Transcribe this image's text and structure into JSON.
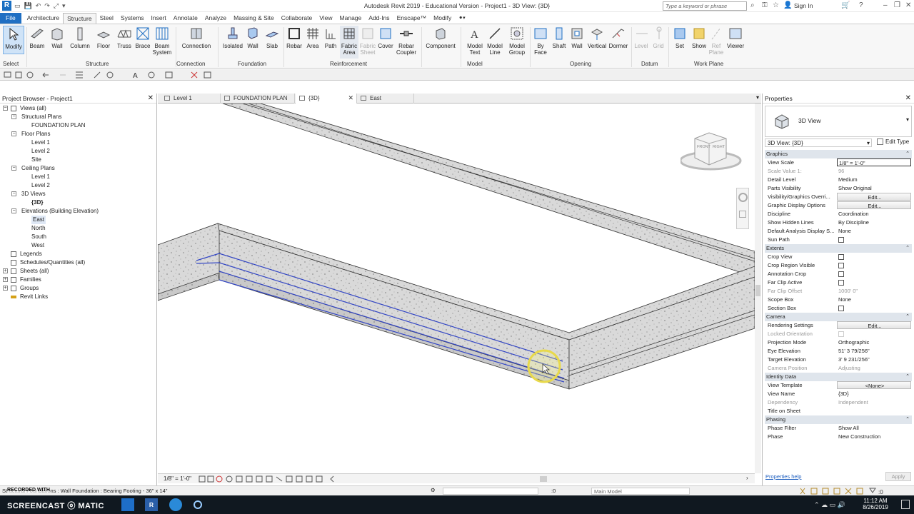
{
  "app": {
    "logo": "R",
    "title": "Autodesk Revit 2019 - Educational Version - Project1 - 3D View: {3D}",
    "search_placeholder": "Type a keyword or phrase",
    "sign_in": "Sign In"
  },
  "menu_tabs": [
    "File",
    "Architecture",
    "Structure",
    "Steel",
    "Systems",
    "Insert",
    "Annotate",
    "Analyze",
    "Massing & Site",
    "Collaborate",
    "View",
    "Manage",
    "Add-Ins",
    "Enscape™",
    "Modify"
  ],
  "active_menu_tab": "Structure",
  "ribbon": {
    "buttons": {
      "modify": "Modify",
      "beam": "Beam",
      "wall": "Wall",
      "column": "Column",
      "floor": "Floor",
      "truss": "Truss",
      "brace": "Brace",
      "beam_system": "Beam System",
      "connection": "Connection",
      "isolated": "Isolated",
      "fwall": "Wall",
      "slab": "Slab",
      "rebar": "Rebar",
      "area": "Area",
      "path": "Path",
      "fabric_area": "Fabric Area",
      "fabric_sheet": "Fabric Sheet",
      "cover": "Cover",
      "rebar_coupler": "Rebar Coupler",
      "component": "Component",
      "model_text": "Model Text",
      "model_line": "Model Line",
      "model_group": "Model Group",
      "by_face": "By Face",
      "shaft": "Shaft",
      "owall": "Wall",
      "vertical": "Vertical",
      "dormer": "Dormer",
      "level": "Level",
      "grid": "Grid",
      "set": "Set",
      "show": "Show",
      "ref_plane": "Ref Plane",
      "viewer": "Viewer"
    },
    "panels": {
      "select": "Select",
      "structure": "Structure",
      "connection": "Connection",
      "foundation": "Foundation",
      "reinforcement": "Reinforcement",
      "model": "Model",
      "opening": "Opening",
      "datum": "Datum",
      "work_plane": "Work Plane"
    }
  },
  "project_browser": {
    "title": "Project Browser - Project1",
    "items": [
      {
        "label": "Views (all)",
        "level": 0,
        "toggle": "−",
        "icon": "views"
      },
      {
        "label": "Structural Plans",
        "level": 1,
        "toggle": "−"
      },
      {
        "label": "FOUNDATION PLAN",
        "level": 2
      },
      {
        "label": "Floor Plans",
        "level": 1,
        "toggle": "−"
      },
      {
        "label": "Level 1",
        "level": 2
      },
      {
        "label": "Level 2",
        "level": 2
      },
      {
        "label": "Site",
        "level": 2
      },
      {
        "label": "Ceiling Plans",
        "level": 1,
        "toggle": "−"
      },
      {
        "label": "Level 1",
        "level": 2
      },
      {
        "label": "Level 2",
        "level": 2
      },
      {
        "label": "3D Views",
        "level": 1,
        "toggle": "−"
      },
      {
        "label": "{3D}",
        "level": 2,
        "bold": true
      },
      {
        "label": "Elevations (Building Elevation)",
        "level": 1,
        "toggle": "−"
      },
      {
        "label": "East",
        "level": 2,
        "selected": true
      },
      {
        "label": "North",
        "level": 2
      },
      {
        "label": "South",
        "level": 2
      },
      {
        "label": "West",
        "level": 2
      },
      {
        "label": "Legends",
        "level": 0,
        "icon": "sheet"
      },
      {
        "label": "Schedules/Quantities (all)",
        "level": 0,
        "icon": "sheet"
      },
      {
        "label": "Sheets (all)",
        "level": 0,
        "toggle": "+",
        "icon": "sheet"
      },
      {
        "label": "Families",
        "level": 0,
        "toggle": "+",
        "icon": "sheet"
      },
      {
        "label": "Groups",
        "level": 0,
        "toggle": "+",
        "icon": "sheet"
      },
      {
        "label": "Revit Links",
        "level": 0,
        "icon": "link"
      }
    ]
  },
  "view_tabs": [
    {
      "label": "Level 1",
      "active": false,
      "closable": false
    },
    {
      "label": "FOUNDATION PLAN",
      "active": false,
      "closable": false
    },
    {
      "label": "{3D}",
      "active": true,
      "closable": true
    },
    {
      "label": "East",
      "active": false,
      "closable": false
    }
  ],
  "viewcube": {
    "front": "FRONT",
    "right": "RIGHT"
  },
  "view_control": {
    "scale": "1/8\" = 1'-0\""
  },
  "properties": {
    "title": "Properties",
    "type_name": "3D View",
    "instance_selector": "3D View: {3D}",
    "edit_type": "Edit Type",
    "help_link": "Properties help",
    "apply": "Apply",
    "groups": [
      {
        "name": "Graphics",
        "rows": [
          {
            "name": "View Scale",
            "value": "1/8\" = 1'-0\"",
            "kind": "input"
          },
          {
            "name": "Scale Value    1:",
            "value": "96",
            "kind": "gray"
          },
          {
            "name": "Detail Level",
            "value": "Medium"
          },
          {
            "name": "Parts Visibility",
            "value": "Show Original"
          },
          {
            "name": "Visibility/Graphics Overri...",
            "value": "Edit...",
            "kind": "button"
          },
          {
            "name": "Graphic Display Options",
            "value": "Edit...",
            "kind": "button"
          },
          {
            "name": "Discipline",
            "value": "Coordination"
          },
          {
            "name": "Show Hidden Lines",
            "value": "By Discipline"
          },
          {
            "name": "Default Analysis Display S...",
            "value": "None"
          },
          {
            "name": "Sun Path",
            "value": "",
            "kind": "checkbox"
          }
        ]
      },
      {
        "name": "Extents",
        "rows": [
          {
            "name": "Crop View",
            "value": "",
            "kind": "checkbox"
          },
          {
            "name": "Crop Region Visible",
            "value": "",
            "kind": "checkbox"
          },
          {
            "name": "Annotation Crop",
            "value": "",
            "kind": "checkbox"
          },
          {
            "name": "Far Clip Active",
            "value": "",
            "kind": "checkbox"
          },
          {
            "name": "Far Clip Offset",
            "value": "1000' 0\"",
            "kind": "gray",
            "gray_name": true
          },
          {
            "name": "Scope Box",
            "value": "None"
          },
          {
            "name": "Section Box",
            "value": "",
            "kind": "checkbox"
          }
        ]
      },
      {
        "name": "Camera",
        "rows": [
          {
            "name": "Rendering Settings",
            "value": "Edit...",
            "kind": "button"
          },
          {
            "name": "Locked Orientation",
            "value": "",
            "kind": "checkbox",
            "gray_name": true
          },
          {
            "name": "Projection Mode",
            "value": "Orthographic"
          },
          {
            "name": "Eye Elevation",
            "value": "51'  3 79/256\""
          },
          {
            "name": "Target Elevation",
            "value": "3'  9 231/256\""
          },
          {
            "name": "Camera Position",
            "value": "Adjusting",
            "kind": "gray",
            "gray_name": true
          }
        ]
      },
      {
        "name": "Identity Data",
        "rows": [
          {
            "name": "View Template",
            "value": "<None>",
            "kind": "button"
          },
          {
            "name": "View Name",
            "value": "{3D}"
          },
          {
            "name": "Dependency",
            "value": "Independent",
            "kind": "gray",
            "gray_name": true
          },
          {
            "name": "Title on Sheet",
            "value": ""
          }
        ]
      },
      {
        "name": "Phasing",
        "rows": [
          {
            "name": "Phase Filter",
            "value": "Show All"
          },
          {
            "name": "Phase",
            "value": "New Construction"
          }
        ]
      }
    ]
  },
  "status": {
    "text": "Structural Foundations : Wall Foundation : Bearing Footing - 36\" x 14\"",
    "watermark": "RECORDED WITH",
    "watermark_brand": "SCREENCAST ⓞ MATIC",
    "zero": ":0",
    "workset": "Main Model"
  },
  "taskbar": {
    "time": "11:12 AM",
    "date": "8/26/2019"
  },
  "colors": {
    "file_tab": "#1f6fc3",
    "selection": "#3346c4",
    "concrete": "#dcdcdc",
    "taskbar": "#101820"
  }
}
